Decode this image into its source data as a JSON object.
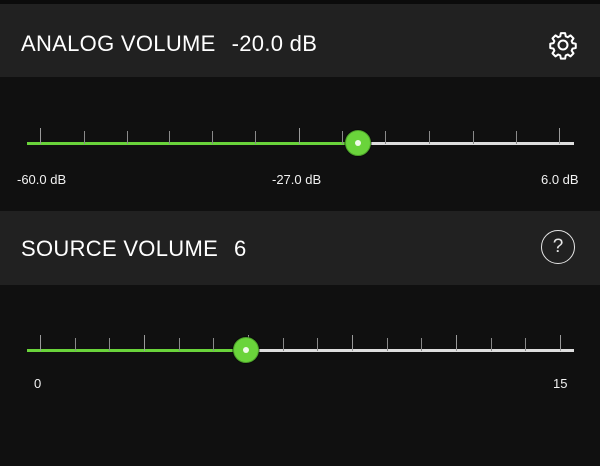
{
  "analog": {
    "title": "ANALOG VOLUME",
    "value_text": "-20.0 dB",
    "settings_icon": "gear-icon",
    "slider": {
      "min_label": "-60.0 dB",
      "mid_label": "-27.0 dB",
      "max_label": "6.0 dB",
      "position_fraction": 0.606
    }
  },
  "source": {
    "title": "SOURCE VOLUME",
    "value_text": "6",
    "help_label": "?",
    "slider": {
      "min_label": "0",
      "max_label": "15",
      "position_fraction": 0.4
    }
  },
  "colors": {
    "accent": "#6ad43b",
    "header_bg": "#212121",
    "panel_bg": "#101010",
    "rail": "#dedede"
  }
}
